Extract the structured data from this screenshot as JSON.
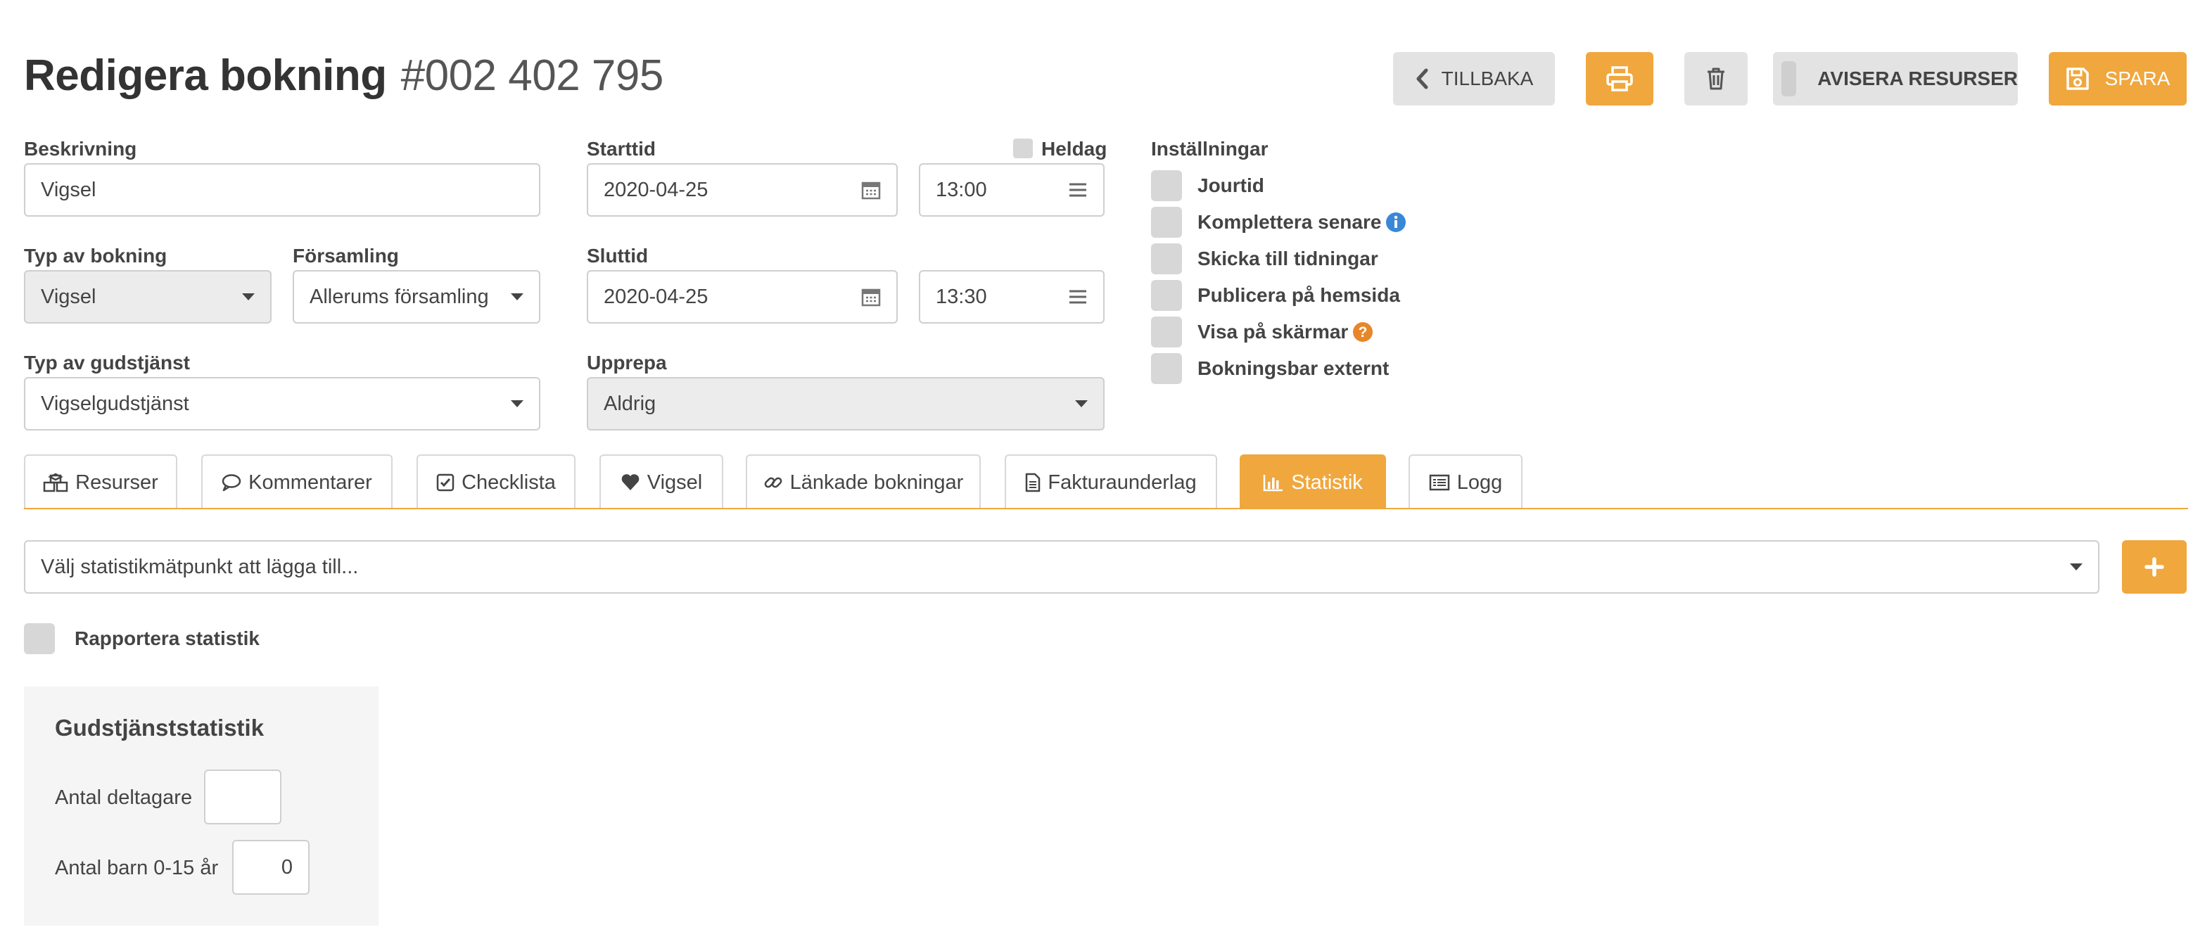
{
  "header": {
    "title": "Redigera bokning",
    "booking_number": "#002 402 795",
    "back_label": "TILLBAKA",
    "notify_label": "AVISERA RESURSER",
    "save_label": "SPARA"
  },
  "form": {
    "description": {
      "label": "Beskrivning",
      "value": "Vigsel"
    },
    "booking_type": {
      "label": "Typ av bokning",
      "value": "Vigsel"
    },
    "parish": {
      "label": "Församling",
      "value": "Allerums församling"
    },
    "service_type": {
      "label": "Typ av gudstjänst",
      "value": "Vigselgudstjänst"
    },
    "start": {
      "label": "Starttid",
      "date": "2020-04-25",
      "time": "13:00"
    },
    "all_day": {
      "label": "Heldag",
      "checked": false
    },
    "end": {
      "label": "Sluttid",
      "date": "2020-04-25",
      "time": "13:30"
    },
    "repeat": {
      "label": "Upprepa",
      "value": "Aldrig"
    }
  },
  "settings": {
    "label": "Inställningar",
    "items": [
      {
        "label": "Jourtid",
        "checked": false
      },
      {
        "label": "Komplettera senare",
        "checked": false
      },
      {
        "label": "Skicka till tidningar",
        "checked": false
      },
      {
        "label": "Publicera på hemsida",
        "checked": false
      },
      {
        "label": "Visa på skärmar",
        "checked": false
      },
      {
        "label": "Bokningsbar externt",
        "checked": false
      }
    ]
  },
  "tabs": [
    {
      "label": "Resurser",
      "icon": "cubes-icon"
    },
    {
      "label": "Kommentarer",
      "icon": "comment-icon"
    },
    {
      "label": "Checklista",
      "icon": "check-square-icon"
    },
    {
      "label": "Vigsel",
      "icon": "heart-icon"
    },
    {
      "label": "Länkade bokningar",
      "icon": "link-icon"
    },
    {
      "label": "Fakturaunderlag",
      "icon": "file-icon"
    },
    {
      "label": "Statistik",
      "icon": "bar-chart-icon",
      "active": true
    },
    {
      "label": "Logg",
      "icon": "list-icon"
    }
  ],
  "statistics": {
    "select_placeholder": "Välj statistikmätpunkt att lägga till...",
    "report_label": "Rapportera statistik",
    "box_title": "Gudstjänststatistik",
    "participants_label": "Antal deltagare",
    "participants_value": "",
    "children_label": "Antal barn 0-15 år",
    "children_value": "0"
  },
  "colors": {
    "accent": "#f0a73d",
    "info": "#3a87d8",
    "help": "#e8862a"
  }
}
